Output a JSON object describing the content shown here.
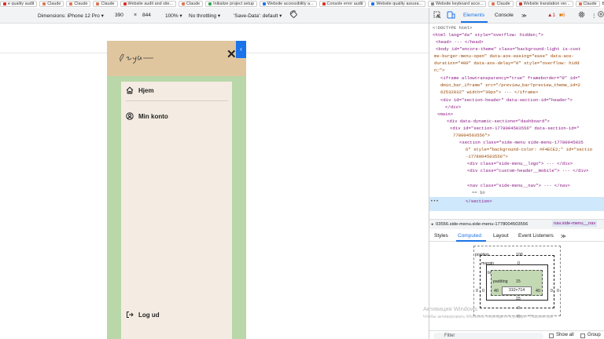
{
  "bookmarks": [
    {
      "label": "e quality audit",
      "color": "#d93025"
    },
    {
      "label": "Claude",
      "color": "#d97757"
    },
    {
      "label": "Claude",
      "color": "#d97757"
    },
    {
      "label": "Claude",
      "color": "#d97757"
    },
    {
      "label": "Website audit and site...",
      "color": "#d93025"
    },
    {
      "label": "Claude",
      "color": "#d97757"
    },
    {
      "label": "Initialize project setup",
      "color": "#34a853"
    },
    {
      "label": "Website accessibility a...",
      "color": "#1a73e8"
    },
    {
      "label": "Console error audit",
      "color": "#d93025"
    },
    {
      "label": "Website quality assura...",
      "color": "#1a73e8"
    },
    {
      "label": "Website keyboard acce...",
      "color": "#888888"
    },
    {
      "label": "Claude",
      "color": "#d97757"
    },
    {
      "label": "Website translation ver...",
      "color": "#d93025"
    },
    {
      "label": "Claude",
      "color": "#d97757"
    }
  ],
  "other_bookmarks": "Все закладк",
  "device_toolbar": {
    "dimensions": "Dimensions: iPhone 12 Pro ▾",
    "width": "390",
    "x": "×",
    "height": "844",
    "zoom": "100% ▾",
    "throttling": "No throttling ▾",
    "save_data": "'Save-Data': default ▾",
    "rotate_icon": "rotate-icon"
  },
  "phone": {
    "logo_text": "Sonja Jensen",
    "close": "✕",
    "handle": "‹",
    "menu": {
      "home": "Hjem",
      "account": "Min konto",
      "logout": "Log ud"
    },
    "colors": {
      "header": "#e0c69f",
      "side": "#b9d7a8",
      "menu": "#F4ECE2"
    }
  },
  "devtools": {
    "tabs": {
      "elements": "Elements",
      "console": "Console",
      "more": "≫",
      "warnings": "▲1",
      "errors": "■6"
    },
    "dom_lines": [
      "<!DOCTYPE html>",
      "<html lang=\"da\" style=\"overflow: hidden;\">",
      "<head> ··· </head>",
      "<body id=\"encore-theme\" class=\"background-light is-cust",
      "me-burger-menu-open\" data-aos-easing=\"ease\" data-aos-",
      "duration=\"400\" data-aos-delay=\"0\" style=\"overflow: hidd",
      "n;\">",
      "<iframe allowtransparency=\"true\" frameborder=\"0\" id=\"",
      "dmin_bar_iframe\" src=\"/preview_bar?preview_theme_id=2",
      "62532032\" width=\"30px\"> ··· </iframe>",
      "<div id=\"section-header\" data-section-id=\"header\">",
      "</div>",
      "<main>",
      "<div data-dynamic-sections=\"dashboard\">",
      "<div id=\"section-1778004503556\" data-section-id=\"",
      "778004503556\">",
      "<section class=\"side-menu side-menu-17780045035",
      "6\" style=\"background-color: #F4ECE2;\" id=\"sectio",
      "-1778004503556\">",
      "<div class=\"side-menu__logo\"> ··· </div>",
      "<div class=\"custom-header__mobile\"> ··· </div>",
      "<nav class=\"side-menu__nav\"> ··· </nav>",
      "== $0",
      "</section>"
    ],
    "breadcrumb": {
      "left": "03556.side-menu.side-menu-1778004503556",
      "right": "nav.side-menu__nav"
    },
    "subtabs": {
      "styles": "Styles",
      "computed": "Computed",
      "layout": "Layout",
      "events": "Event Listeners",
      "more": "≫"
    },
    "box_model": {
      "position_label": "position",
      "position_val": "100",
      "margin_label": "margin",
      "margin_val": "0",
      "border_label": "border",
      "border_val": "0",
      "padding_label": "padding",
      "padding_val": "15",
      "content": "310×714",
      "left": "40",
      "right": "40",
      "bottom_pad": "15",
      "outer_left": "0",
      "outer_right": "0",
      "border_left": "0",
      "border_right": "0",
      "margin_bottom": "0",
      "position_bottom": "0",
      "position_right": "0"
    },
    "filter": {
      "placeholder": "Filter",
      "show_all": "Show all",
      "group": "Group"
    }
  },
  "watermark": {
    "line1": "Активация Windows",
    "line2": "Чтобы активировать Windows, перейдите в раздел \"Параметры\"."
  }
}
